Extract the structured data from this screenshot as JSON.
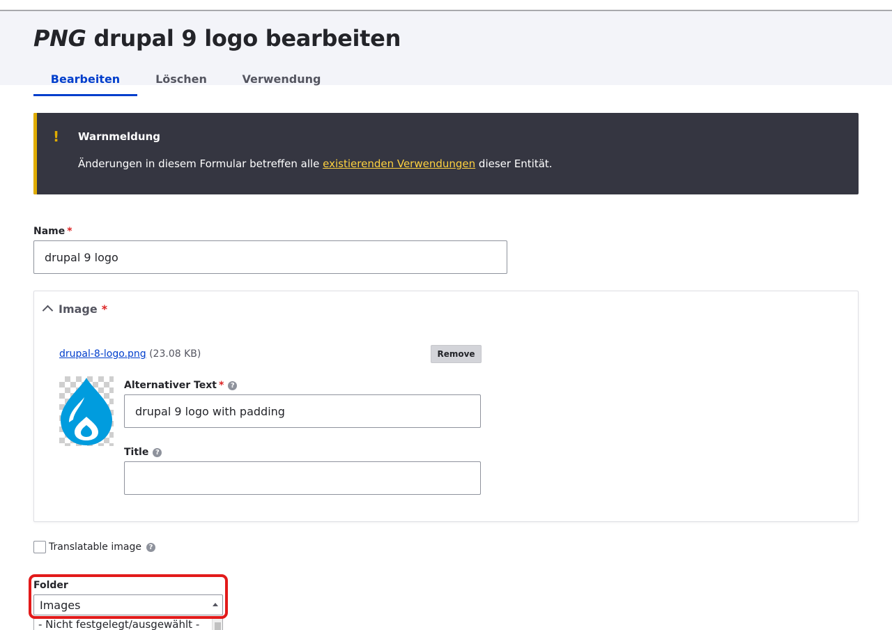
{
  "header": {
    "title_type": "PNG",
    "title_name": "drupal 9 logo bearbeiten",
    "tabs": [
      {
        "label": "Bearbeiten",
        "active": true
      },
      {
        "label": "Löschen",
        "active": false
      },
      {
        "label": "Verwendung",
        "active": false
      }
    ]
  },
  "warning": {
    "icon": "!",
    "title": "Warnmeldung",
    "text_before": "Änderungen in diesem Formular betreffen alle ",
    "link_text": "existierenden Verwendungen",
    "text_after": " dieser Entität."
  },
  "name_field": {
    "label": "Name",
    "required_mark": "*",
    "value": "drupal 9 logo"
  },
  "image_section": {
    "summary": "Image",
    "required_mark": "*",
    "file_name": "drupal-8-logo.png",
    "file_size": "(23.08 KB)",
    "remove_label": "Remove",
    "alt_label": "Alternativer Text",
    "alt_required_mark": "*",
    "alt_value": "drupal 9 logo with padding",
    "title_label": "Title",
    "title_value": "",
    "help_icon_glyph": "?"
  },
  "translatable": {
    "label": "Translatable image",
    "checked": false
  },
  "folder": {
    "label": "Folder",
    "selected": "Images",
    "open_option": "- Nicht festgelegt/ausgewählt -"
  },
  "colors": {
    "accent": "#003ecc",
    "warning_bg": "#353641",
    "warning_accent": "#e0ac00",
    "required": "#dc2323",
    "highlight": "#e21a1a",
    "drupal_blue": "#009cde"
  }
}
